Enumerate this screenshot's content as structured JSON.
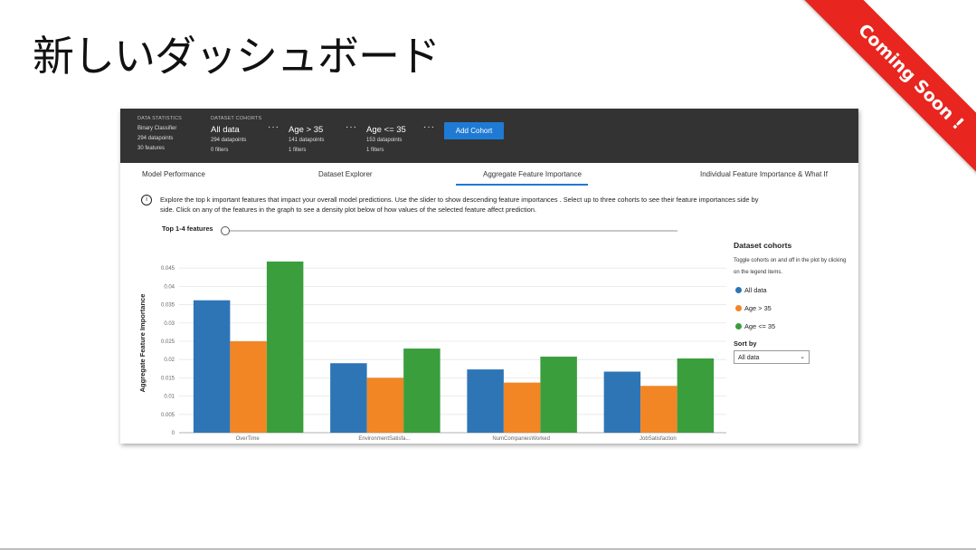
{
  "slide": {
    "title": "新しいダッシュボード",
    "ribbon": "Coming Soon !"
  },
  "topbar": {
    "stats_head": "DATA STATISTICS",
    "stats_lines": [
      "Binary Classifier",
      "294 datapoints",
      "30 features"
    ],
    "cohorts_head": "DATASET COHORTS",
    "cohorts": [
      {
        "name": "All data",
        "datapoints": "294 datapoints",
        "filters": "0 filters"
      },
      {
        "name": "Age > 35",
        "datapoints": "141 datapoints",
        "filters": "1 filters"
      },
      {
        "name": "Age <= 35",
        "datapoints": "153 datapoints",
        "filters": "1 filters"
      }
    ],
    "dots": "···",
    "add_cohort": "Add Cohort"
  },
  "tabs": [
    "Model Performance",
    "Dataset Explorer",
    "Aggregate Feature Importance",
    "Individual Feature Importance & What If"
  ],
  "active_tab": 2,
  "info": {
    "icon": "i",
    "text": "Explore the top k important features that impact your overall model predictions. Use the slider to show descending feature importances . Select up to three cohorts to see their feature importances side by side. Click on any of the features in the graph to see a density plot below of how values of the selected feature affect prediction."
  },
  "topk": {
    "label": "Top 1-4 features",
    "value": "1-4"
  },
  "side": {
    "title": "Dataset cohorts",
    "desc": "Toggle cohorts on and off in the plot by clicking on the legend items.",
    "sort_label": "Sort by",
    "sort_value": "All data"
  },
  "colors": {
    "all": "#2e75b6",
    "gt35": "#f28524",
    "le35": "#3a9e3d",
    "topbar": "#333333",
    "accent": "#1f7ad4"
  },
  "chart_data": {
    "type": "bar",
    "ylabel": "Aggregate Feature Importance",
    "xlabel": "",
    "categories": [
      "OverTime",
      "EnvironmentSatisfa...",
      "NumCompaniesWorked",
      "JobSatisfaction"
    ],
    "series": [
      {
        "name": "All data",
        "values": [
          0.0362,
          0.019,
          0.0173,
          0.0167
        ]
      },
      {
        "name": "Age > 35",
        "values": [
          0.025,
          0.015,
          0.0137,
          0.0128
        ]
      },
      {
        "name": "Age <= 35",
        "values": [
          0.0468,
          0.023,
          0.0208,
          0.0203
        ]
      }
    ],
    "yticks": [
      "0",
      "0.005",
      "0.01",
      "0.015",
      "0.02",
      "0.025",
      "0.03",
      "0.035",
      "0.04",
      "0.045"
    ],
    "ylim": [
      0,
      0.049
    ],
    "grid": true
  }
}
